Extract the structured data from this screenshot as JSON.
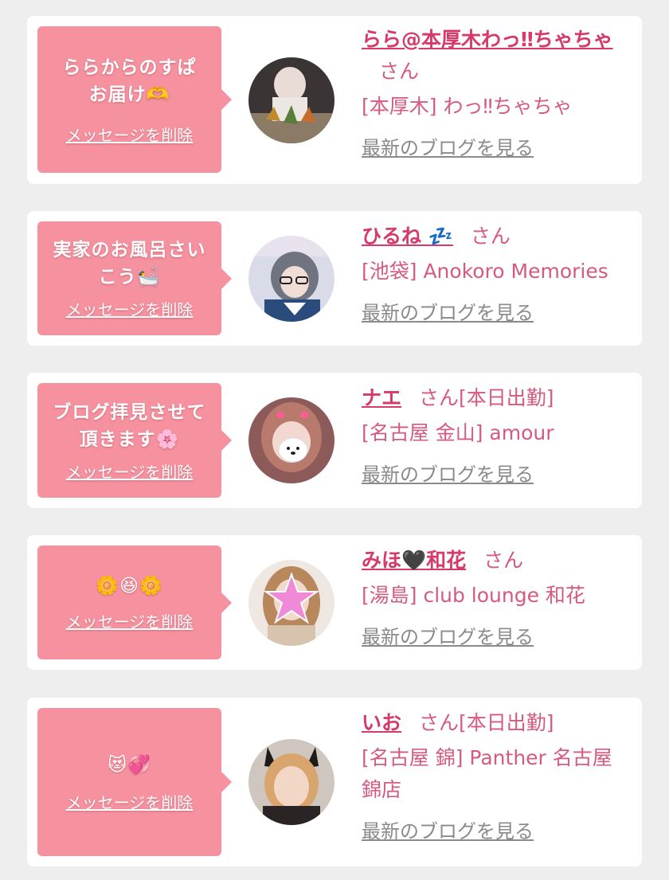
{
  "colors": {
    "bubble": "#f6919f",
    "name": "#d63a6a",
    "shop": "#d65a80",
    "blog_link": "#8a8a8a",
    "background": "#eeeeee"
  },
  "messages": [
    {
      "message": "ららからのすぱお届け🫶",
      "delete_label": "メッセージを削除",
      "name": "らら@本厚木わっ‼ちゃちゃ",
      "honorific": "さん",
      "status": "",
      "shop": "[本厚木] わっ‼ちゃちゃ",
      "blog_label": "最新のブログを見る"
    },
    {
      "message": "実家のお風呂さいこう🛀",
      "delete_label": "メッセージを削除",
      "name": "ひるね 💤",
      "honorific": "さん",
      "status": "",
      "shop": "[池袋] Anokoro Memories",
      "blog_label": "最新のブログを見る"
    },
    {
      "message": "ブログ拝見させて頂きます🌸",
      "delete_label": "メッセージを削除",
      "name": "ナエ",
      "honorific": "さん",
      "status": "[本日出勤]",
      "shop": "[名古屋 金山] amour",
      "blog_label": "最新のブログを見る"
    },
    {
      "message": "🌼😆🌼",
      "delete_label": "メッセージを削除",
      "name": "みほ🖤和花",
      "honorific": "さん",
      "status": "",
      "shop": "[湯島] club lounge 和花",
      "blog_label": "最新のブログを見る"
    },
    {
      "message": "😻💞",
      "delete_label": "メッセージを削除",
      "name": "いお",
      "honorific": "さん",
      "status": "[本日出勤]",
      "shop": "[名古屋 錦] Panther 名古屋錦店",
      "blog_label": "最新のブログを見る"
    }
  ]
}
